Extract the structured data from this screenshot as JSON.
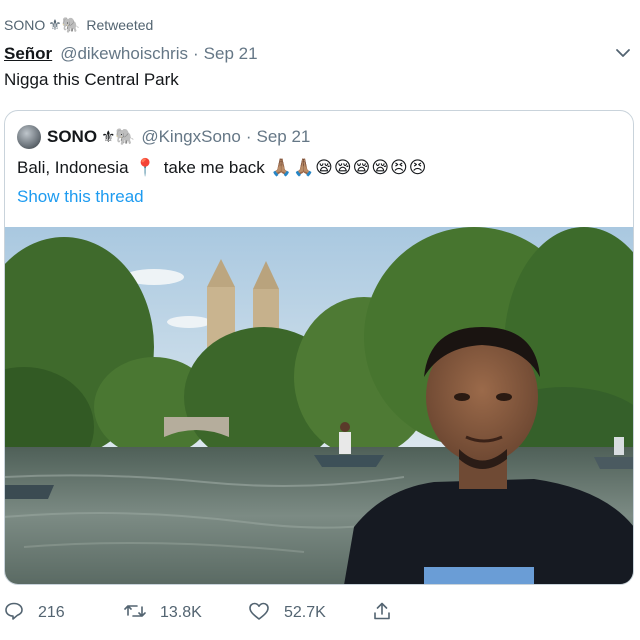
{
  "retweet": {
    "retweeter_name": "SONO",
    "retweeter_emoji": "⚜🐘",
    "label": "Retweeted"
  },
  "tweet": {
    "author_name": "Señor",
    "author_handle": "@dikewhoischris",
    "separator": "·",
    "date": "Sep 21",
    "text": "Nigga this Central Park"
  },
  "quoted_tweet": {
    "author_name": "SONO",
    "author_emoji": "⚜🐘",
    "author_handle": "@KingxSono",
    "separator": "·",
    "date": "Sep 21",
    "text_start": "Bali, Indonesia",
    "pin_emoji": "📍",
    "text_end": "take me back",
    "tail_emoji": "🙏🏽🙏🏽😪😪😪😪😣😣",
    "thread_link": "Show this thread"
  },
  "actions": {
    "reply_count": "216",
    "retweet_count": "13.8K",
    "like_count": "52.7K"
  },
  "icons": {
    "caret": "chevron-down-icon",
    "reply": "reply-icon",
    "retweet": "retweet-icon",
    "like": "heart-icon",
    "share": "share-icon"
  },
  "colors": {
    "link": "#1d9bf0",
    "secondary_text": "#657786",
    "border": "#c9d3db"
  }
}
